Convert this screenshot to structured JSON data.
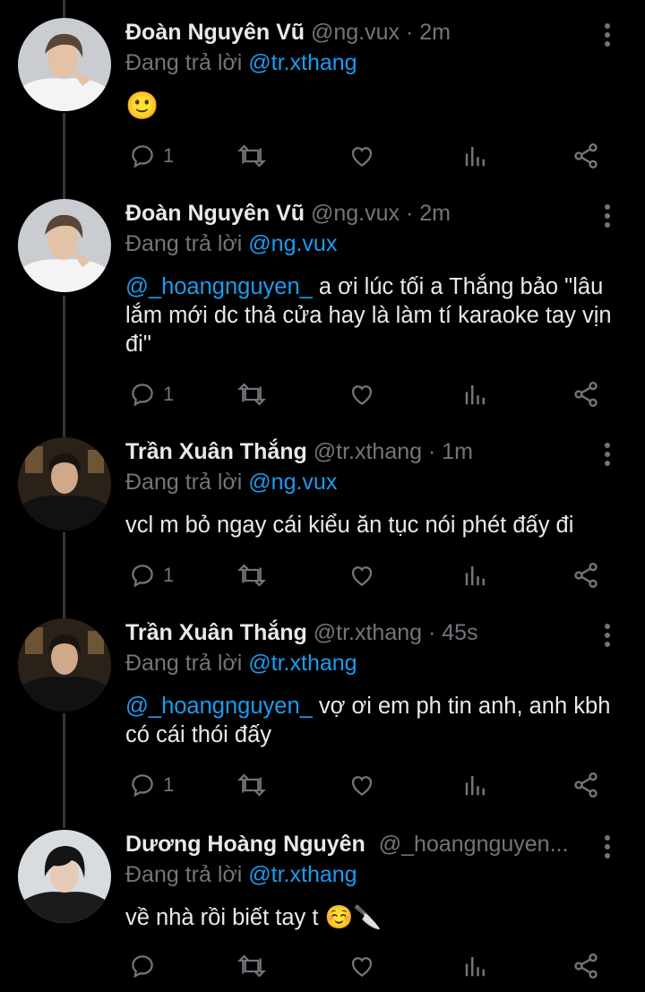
{
  "tweets": [
    {
      "name": "Đoàn Nguyên Vũ",
      "handle": "@ng.vux",
      "sep": "·",
      "time": "2m",
      "reply_prefix": "Đang trả lời ",
      "reply_to": "@tr.xthang",
      "mention": "",
      "text": "🙂",
      "reply_count": "1",
      "avatar_icon": "avatar-white-shirt"
    },
    {
      "name": "Đoàn Nguyên Vũ",
      "handle": "@ng.vux",
      "sep": "·",
      "time": "2m",
      "reply_prefix": "Đang trả lời ",
      "reply_to": "@ng.vux",
      "mention": "@_hoangnguyen_",
      "text": " a ơi lúc tối a Thắng bảo \"lâu lắm mới dc thả cửa hay là làm tí karaoke tay vịn đi\"",
      "reply_count": "1",
      "avatar_icon": "avatar-white-shirt"
    },
    {
      "name": "Trần Xuân Thắng",
      "handle": "@tr.xthang",
      "sep": "·",
      "time": "1m",
      "reply_prefix": "Đang trả lời ",
      "reply_to": "@ng.vux",
      "mention": "",
      "text": "vcl m bỏ ngay cái kiểu ăn tục nói phét đấy đi",
      "reply_count": "1",
      "avatar_icon": "avatar-black-jacket"
    },
    {
      "name": "Trần Xuân Thắng",
      "handle": "@tr.xthang",
      "sep": "·",
      "time": "45s",
      "reply_prefix": "Đang trả lời ",
      "reply_to": "@tr.xthang",
      "mention": "@_hoangnguyen_",
      "text": " vợ ơi em ph tin anh, anh kbh có cái thói đấy",
      "reply_count": "1",
      "avatar_icon": "avatar-black-jacket"
    },
    {
      "name": "Dương Hoàng Nguyên",
      "handle": "@_hoangnguyen...",
      "sep": "",
      "time": "",
      "reply_prefix": "Đang trả lời ",
      "reply_to": "@tr.xthang",
      "mention": "",
      "text": "về nhà rồi biết tay t ☺️🔪",
      "reply_count": "",
      "avatar_icon": "avatar-black-hair"
    }
  ],
  "colors": {
    "background": "#000000",
    "text": "#e7e9ea",
    "muted": "#71767b",
    "accent": "#1d9bf0",
    "thread_line": "#333639"
  },
  "action_icons": [
    "reply-icon",
    "retweet-icon",
    "like-icon",
    "views-icon",
    "share-icon"
  ]
}
